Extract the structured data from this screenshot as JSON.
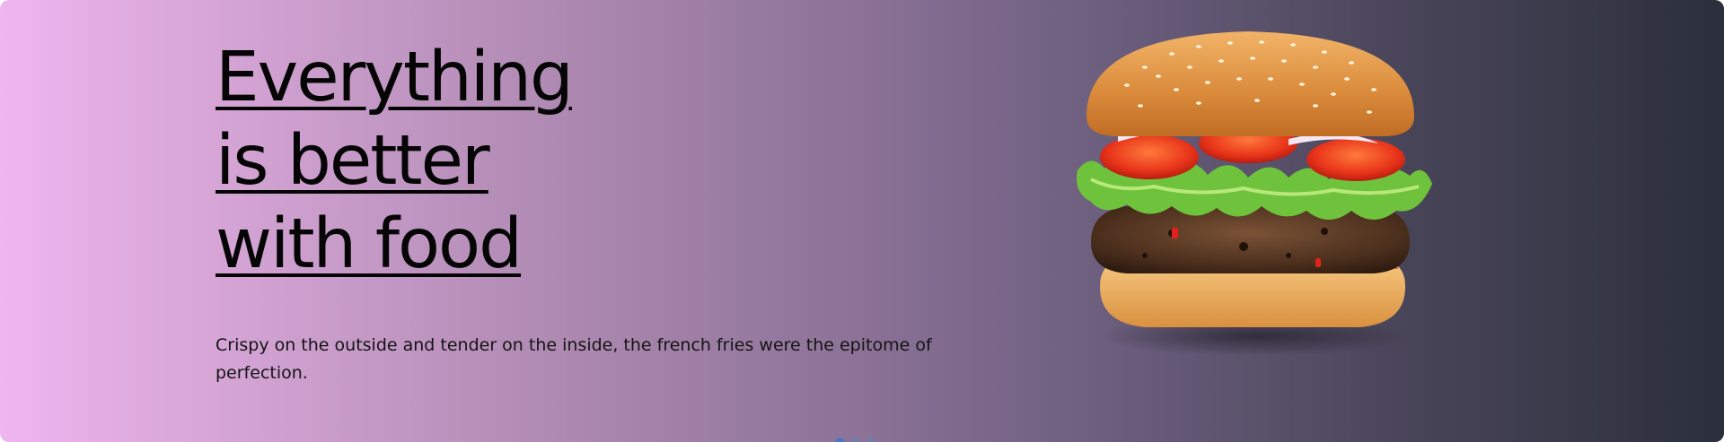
{
  "hero": {
    "headline_lines": [
      "Everything",
      "is better",
      "with food"
    ],
    "tagline": "Crispy on the outside and tender on the inside, the french fries were the epitome of perfection.",
    "image_icon": "burger-image",
    "carousel_slides": 3,
    "carousel_active_index": 0
  },
  "colors": {
    "gradient_start": "#efb5ef",
    "gradient_end": "#2b2f3c",
    "text": "#050505"
  }
}
